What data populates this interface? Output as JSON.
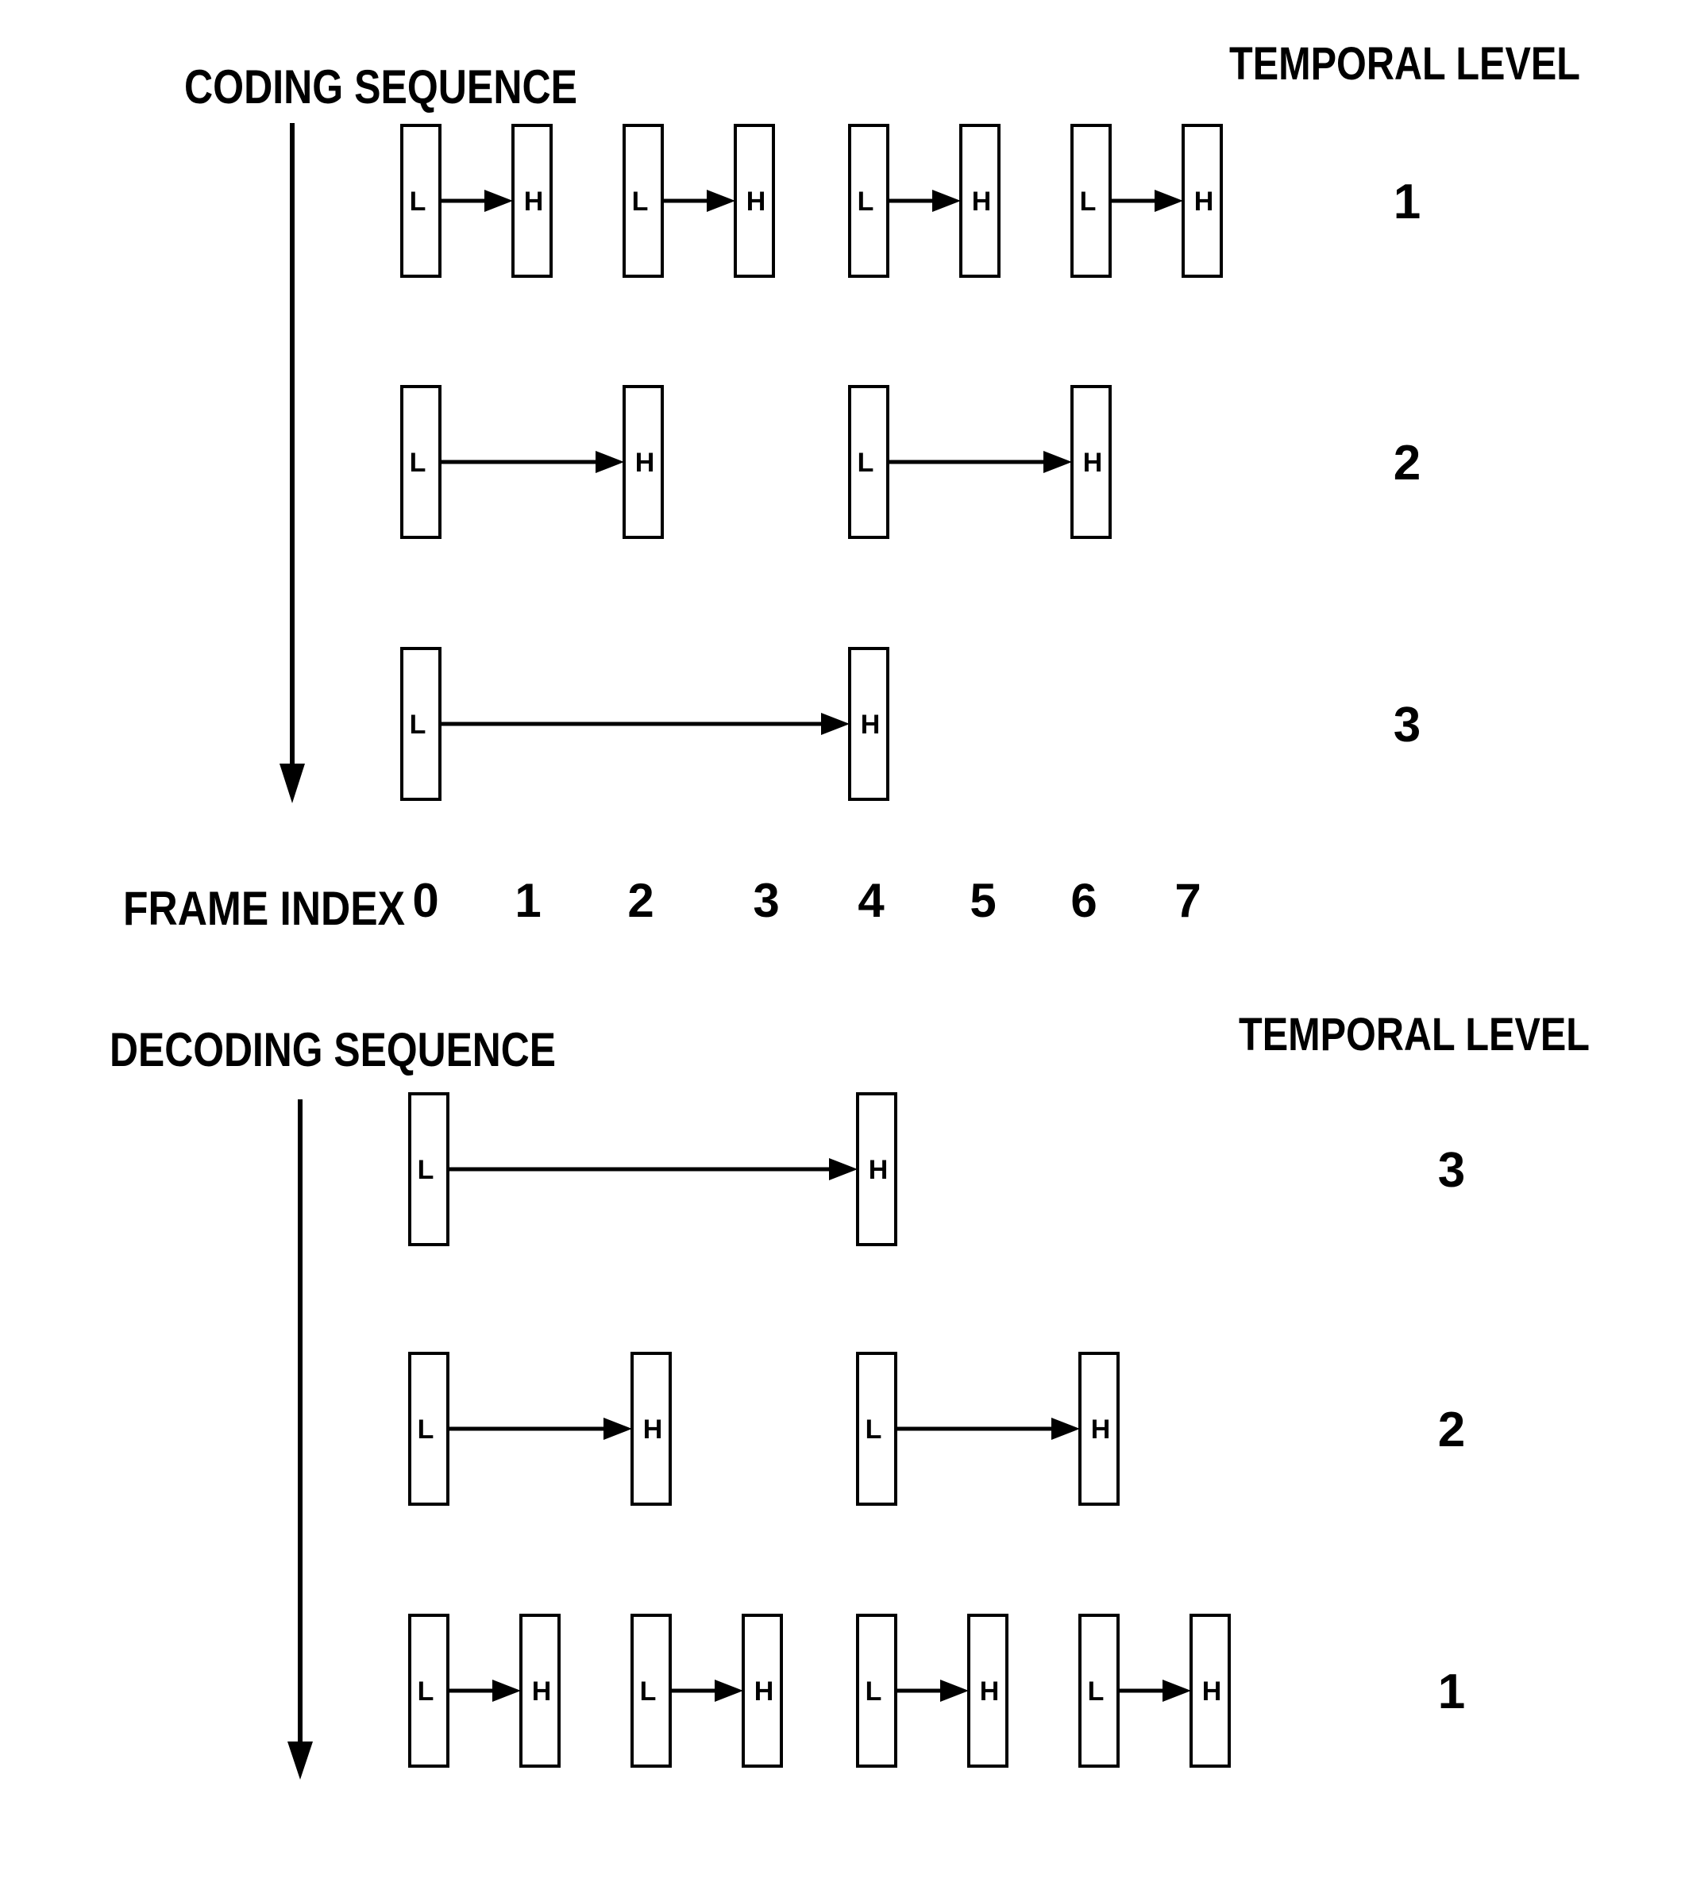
{
  "coding": {
    "title": "CODING SEQUENCE",
    "level_header": "TEMPORAL LEVEL",
    "rows": [
      {
        "level": "1",
        "pairs": [
          {
            "low": "L",
            "high": "H",
            "from_frame": 0,
            "to_frame": 1
          },
          {
            "low": "L",
            "high": "H",
            "from_frame": 2,
            "to_frame": 3
          },
          {
            "low": "L",
            "high": "H",
            "from_frame": 4,
            "to_frame": 5
          },
          {
            "low": "L",
            "high": "H",
            "from_frame": 6,
            "to_frame": 7
          }
        ]
      },
      {
        "level": "2",
        "pairs": [
          {
            "low": "L",
            "high": "H",
            "from_frame": 0,
            "to_frame": 2
          },
          {
            "low": "L",
            "high": "H",
            "from_frame": 4,
            "to_frame": 6
          }
        ]
      },
      {
        "level": "3",
        "pairs": [
          {
            "low": "L",
            "high": "H",
            "from_frame": 0,
            "to_frame": 4
          }
        ]
      }
    ]
  },
  "frame_index": {
    "label": "FRAME INDEX",
    "values": [
      "0",
      "1",
      "2",
      "3",
      "4",
      "5",
      "6",
      "7"
    ]
  },
  "decoding": {
    "title": "DECODING SEQUENCE",
    "level_header": "TEMPORAL LEVEL",
    "rows": [
      {
        "level": "3",
        "pairs": [
          {
            "low": "L",
            "high": "H",
            "from_frame": 0,
            "to_frame": 4
          }
        ]
      },
      {
        "level": "2",
        "pairs": [
          {
            "low": "L",
            "high": "H",
            "from_frame": 0,
            "to_frame": 2
          },
          {
            "low": "L",
            "high": "H",
            "from_frame": 4,
            "to_frame": 6
          }
        ]
      },
      {
        "level": "1",
        "pairs": [
          {
            "low": "L",
            "high": "H",
            "from_frame": 0,
            "to_frame": 1
          },
          {
            "low": "L",
            "high": "H",
            "from_frame": 2,
            "to_frame": 3
          },
          {
            "low": "L",
            "high": "H",
            "from_frame": 4,
            "to_frame": 5
          },
          {
            "low": "L",
            "high": "H",
            "from_frame": 6,
            "to_frame": 7
          }
        ]
      }
    ]
  }
}
